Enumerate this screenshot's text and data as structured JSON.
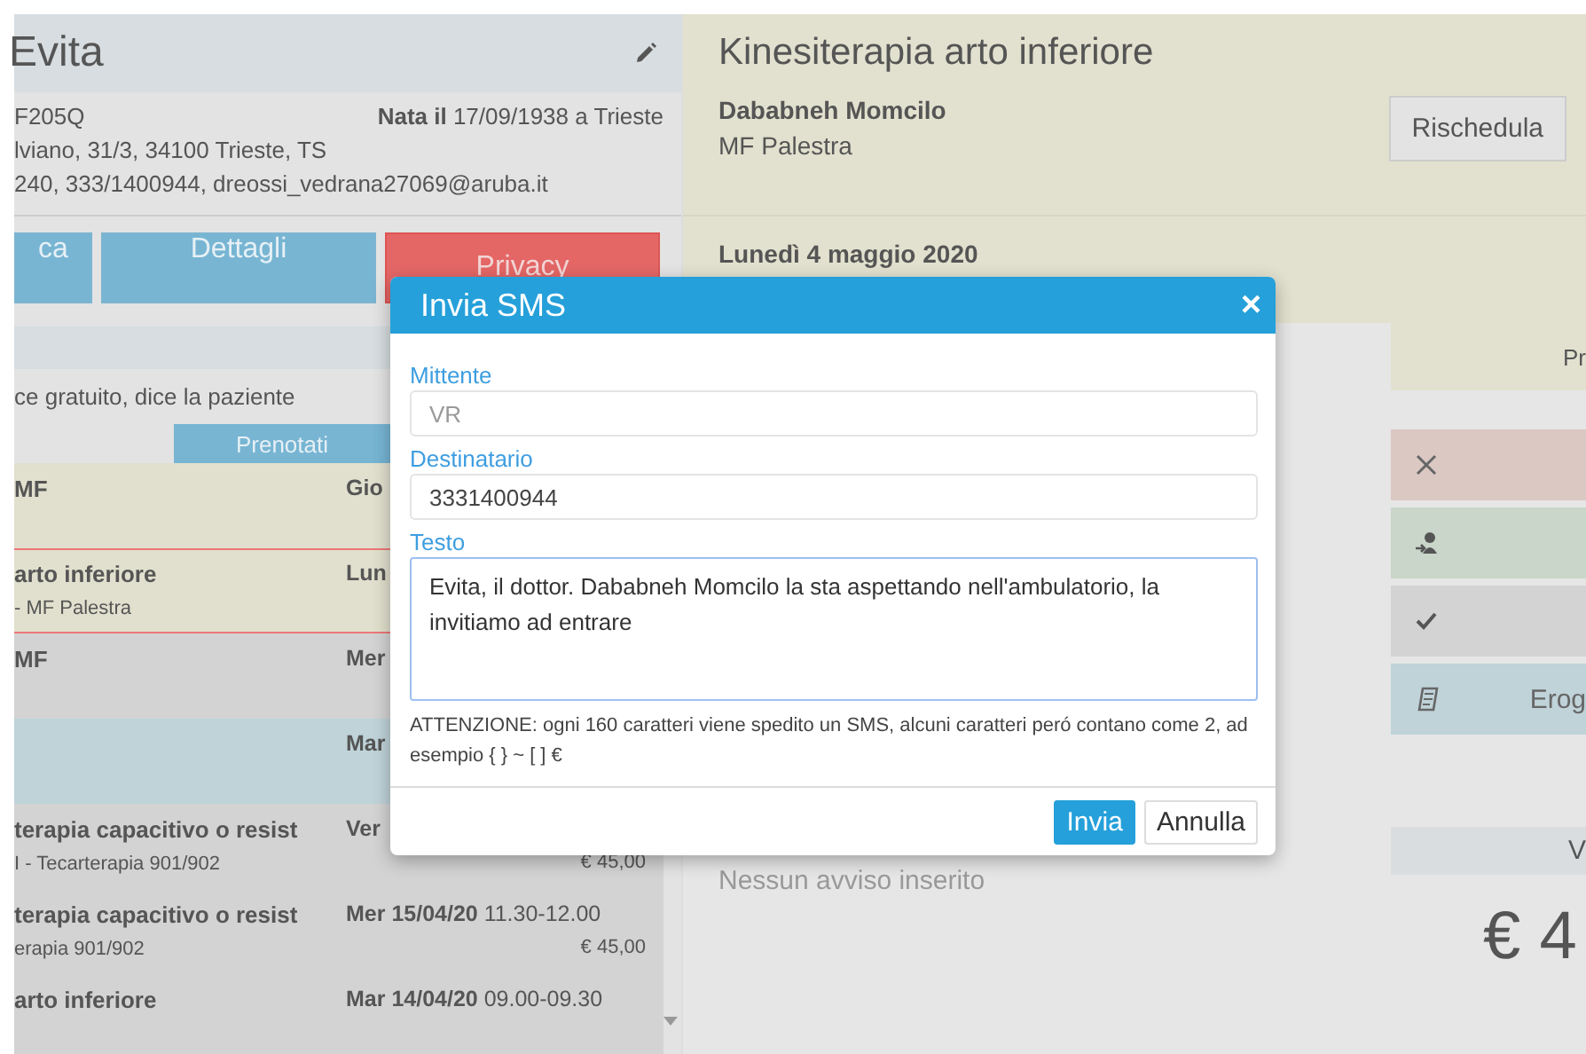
{
  "patient": {
    "name": "Evita",
    "code": "F205Q",
    "birth_label": "Nata il",
    "birth_value": "17/09/1938 a Trieste",
    "address": "lviano, 31/3, 34100 Trieste, TS",
    "contacts": "240, 333/1400944, dreossi_vedrana27069@aruba.it"
  },
  "patient_buttons": [
    {
      "label": "ca",
      "kind": "info"
    },
    {
      "label": "Dettagli",
      "kind": "info"
    },
    {
      "label": "Privacy",
      "kind": "danger"
    }
  ],
  "note": "ce gratuito, dice la paziente",
  "tabs": [
    {
      "label": "Prenotati",
      "selected": true
    }
  ],
  "appointments": [
    {
      "title": "MF",
      "date": "Gio",
      "kind": "booked",
      "current": false
    },
    {
      "title": "arto inferiore",
      "date": "Lun",
      "subtitle": "- MF Palestra",
      "kind": "booked",
      "current": true
    },
    {
      "title": "MF",
      "date": "Mer",
      "kind": "past",
      "current": false
    },
    {
      "date": "Mar",
      "kind": "info",
      "current": false
    },
    {
      "title": "terapia capacitivo o resist",
      "date": "Ver",
      "subtitle": "I - Tecarterapia 901/902",
      "price": "€ 45,00",
      "kind": "past",
      "current": false
    },
    {
      "title": "terapia capacitivo o resist",
      "date": "Mer 15/04/20",
      "time": "11.30-12.00",
      "subtitle": "erapia 901/902",
      "price": "€ 45,00",
      "kind": "past",
      "current": false
    },
    {
      "title": "arto inferiore",
      "date": "Mar 14/04/20",
      "time": "09.00-09.30",
      "kind": "past",
      "current": false
    }
  ],
  "appointment": {
    "title": "Kinesiterapia arto inferiore",
    "therapist": "Dababneh Momcilo",
    "location": "MF Palestra",
    "date": "Lunedì 4 maggio 2020"
  },
  "header_buttons": [
    "Rischedula"
  ],
  "notice": "Nessun avviso inserito",
  "side": {
    "status": "Pr",
    "actions": [
      {
        "kind": "cancel"
      },
      {
        "kind": "arrive"
      },
      {
        "kind": "done"
      },
      {
        "kind": "deliver",
        "label": "Erog"
      }
    ],
    "total_label": "V",
    "total": "€ 4"
  },
  "modal": {
    "title": "Invia SMS",
    "close": "×",
    "fields": [
      {
        "label": "Mittente",
        "value": "VR",
        "disabled": true
      },
      {
        "label": "Destinatario",
        "value": "3331400944",
        "disabled": false
      }
    ],
    "text_label": "Testo",
    "text": "Evita, il dottor. Dababneh Momcilo la sta aspettando nell'ambulatorio, la invitiamo ad entrare",
    "warning": "ATTENZIONE: ogni 160 caratteri viene spedito un SMS, alcuni caratteri peró contano come 2, ad esempio { } ~ [ ] €",
    "buttons": [
      {
        "label": "Invia",
        "kind": "primary"
      },
      {
        "label": "Annulla",
        "kind": "default"
      }
    ]
  }
}
